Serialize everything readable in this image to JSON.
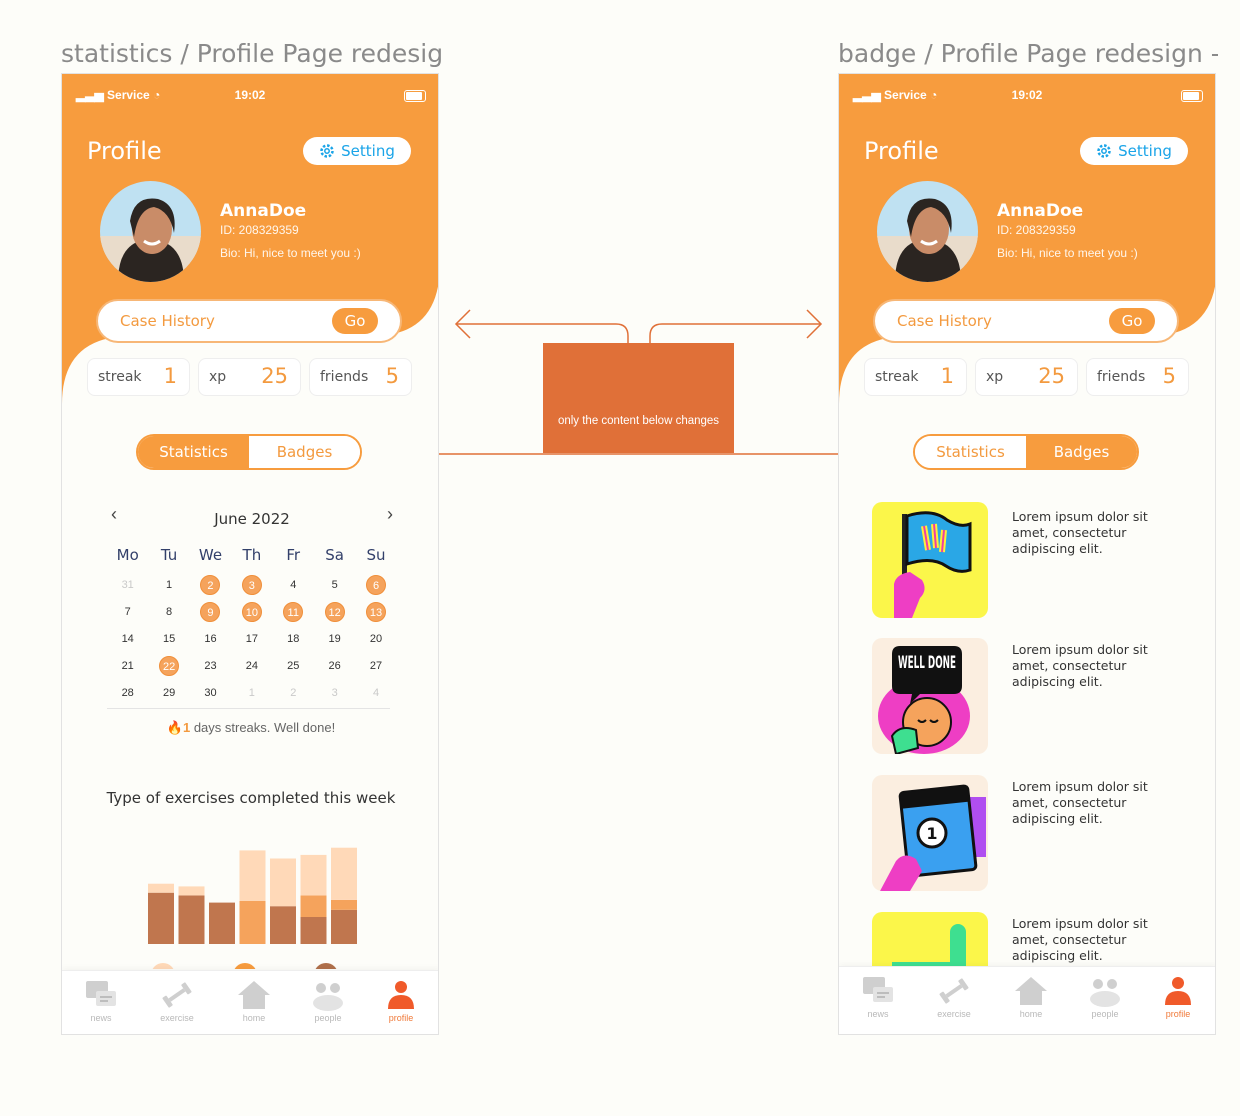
{
  "frames": {
    "left_title": "statistics / Profile Page redesign - badge",
    "right_title": "badge / Profile Page redesign - badge"
  },
  "status_bar": {
    "carrier": "Service",
    "time": "19:02"
  },
  "profile": {
    "title": "Profile",
    "setting_label": "Setting",
    "username": "AnnaDoe",
    "id_text": "ID: 208329359",
    "bio": "Bio: Hi, nice to meet you :)",
    "case_history_label": "Case History",
    "go_label": "Go"
  },
  "stats": [
    {
      "label": "streak",
      "value": "1"
    },
    {
      "label": "xp",
      "value": "25"
    },
    {
      "label": "friends",
      "value": "5"
    }
  ],
  "toggle": {
    "statistics": "Statistics",
    "badges": "Badges"
  },
  "calendar": {
    "month": "June 2022",
    "weekdays": [
      "Mo",
      "Tu",
      "We",
      "Th",
      "Fr",
      "Sa",
      "Su"
    ],
    "days": [
      {
        "d": "31",
        "o": true
      },
      {
        "d": "1"
      },
      {
        "d": "2",
        "c": true
      },
      {
        "d": "3",
        "c": true
      },
      {
        "d": "4"
      },
      {
        "d": "5"
      },
      {
        "d": "6",
        "c": true
      },
      {
        "d": "7"
      },
      {
        "d": "8"
      },
      {
        "d": "9",
        "c": true
      },
      {
        "d": "10",
        "c": true
      },
      {
        "d": "11",
        "c": true
      },
      {
        "d": "12",
        "c": true
      },
      {
        "d": "13",
        "c": true
      },
      {
        "d": "14"
      },
      {
        "d": "15"
      },
      {
        "d": "16"
      },
      {
        "d": "17"
      },
      {
        "d": "18"
      },
      {
        "d": "19"
      },
      {
        "d": "20"
      },
      {
        "d": "21"
      },
      {
        "d": "22",
        "c": true
      },
      {
        "d": "23"
      },
      {
        "d": "24"
      },
      {
        "d": "25"
      },
      {
        "d": "26"
      },
      {
        "d": "27"
      },
      {
        "d": "28"
      },
      {
        "d": "29"
      },
      {
        "d": "30"
      },
      {
        "d": "1",
        "o": true
      },
      {
        "d": "2",
        "o": true
      },
      {
        "d": "3",
        "o": true
      },
      {
        "d": "4",
        "o": true
      }
    ],
    "streak_num": "1",
    "streak_text": " days streaks. Well done!"
  },
  "chart": {
    "title": "Type of exercises completed this week"
  },
  "chart_data": {
    "type": "bar",
    "stacked": true,
    "categories": [
      "",
      "",
      "",
      "",
      "",
      "",
      ""
    ],
    "series": [
      {
        "color": "#c0764e",
        "values": [
          57,
          54,
          46,
          0,
          42,
          30,
          38
        ]
      },
      {
        "color": "#f5a35c",
        "values": [
          0,
          0,
          0,
          48,
          0,
          24,
          11
        ]
      },
      {
        "color": "#ffd9b8",
        "values": [
          10,
          10,
          0,
          56,
          53,
          45,
          58
        ]
      }
    ],
    "legend_dots": [
      "#ffd9b8",
      "#f79c3e",
      "#b0704b"
    ],
    "ylim": [
      0,
      120
    ]
  },
  "badges": [
    {
      "text": "Lorem ipsum dolor sit amet, consectetur adipiscing elit."
    },
    {
      "text": "Lorem ipsum dolor sit amet, consectetur adipiscing elit."
    },
    {
      "text": "Lorem ipsum dolor sit amet, consectetur adipiscing elit."
    },
    {
      "text": "Lorem ipsum dolor sit amet, consectetur adipiscing elit."
    }
  ],
  "badge_art": {
    "text": "WELL DONE",
    "number": "1"
  },
  "tabs": [
    {
      "label": "news"
    },
    {
      "label": "exercise"
    },
    {
      "label": "home"
    },
    {
      "label": "people"
    },
    {
      "label": "profile"
    }
  ],
  "annotation": {
    "text": "only the content below changes"
  },
  "colors": {
    "orange": "#f79c3e",
    "accent": "#e07038",
    "setting_blue": "#1aa4e8"
  }
}
